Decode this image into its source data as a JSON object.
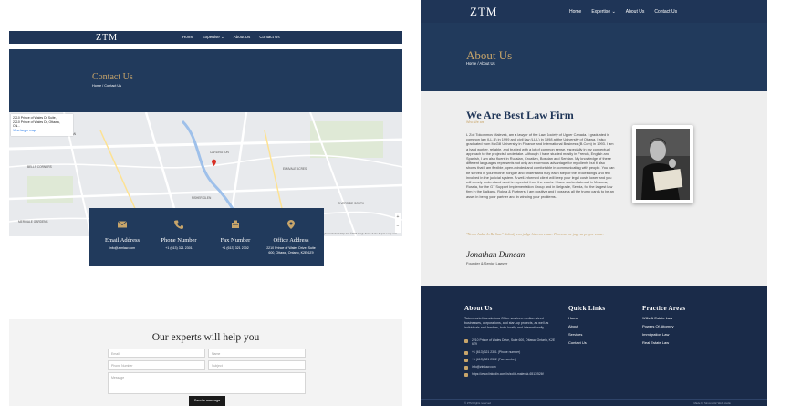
{
  "contact_page": {
    "nav": {
      "logo": "ZTM",
      "links": [
        "Home",
        "Expertise ⌄",
        "About Us",
        "Contact Us"
      ]
    },
    "hero": {
      "title": "Contact Us",
      "breadcrumb": "Home  /  Contact Us"
    },
    "map": {
      "card_address": "2210 Prince of Wales Dr Suite, 2210 Prince of Wales Dr, Ottawa, ON...",
      "card_link": "View larger map",
      "footer": "Keyboard shortcuts   Map data ©2023 Google   Terms of Use   Report a map error",
      "labels": [
        "NEPEAN",
        "CARLINGTON",
        "ELMVALE ACRES",
        "BELLS CORNERS",
        "MERIVALE GARDENS",
        "FISHER GLEN",
        "RIVERSIDE SOUTH"
      ]
    },
    "contact_cards": [
      {
        "heading": "Email Address",
        "detail": "info@ztmlaw.com",
        "icon": "envelope-icon"
      },
      {
        "heading": "Phone Number",
        "detail": "+1 (613) 321 2301",
        "icon": "phone-icon"
      },
      {
        "heading": "Fax Number",
        "detail": "+1 (613) 321 2302",
        "icon": "fax-icon"
      },
      {
        "heading": "Office Address",
        "detail": "2210 Prince of Wales Drive, Suite 600, Ottawa, Ontario, K2E 6Z9",
        "icon": "map-pin-icon"
      }
    ],
    "form": {
      "title": "Our experts will help you",
      "email_placeholder": "Email",
      "name_placeholder": "Name",
      "phone_placeholder": "Phone Number",
      "subject_placeholder": "Subject",
      "message_placeholder": "Message",
      "submit_label": "Send a message"
    }
  },
  "about_page": {
    "nav": {
      "logo": "ZTM",
      "links": [
        "Home",
        "Expertise ⌄",
        "About Us",
        "Contact Us"
      ]
    },
    "hero": {
      "title": "About Us",
      "breadcrumb": "Home  /  About Us"
    },
    "bio": {
      "title": "We Are Best Law Firm",
      "subtitle": "Who We are",
      "text": "L Zoli Tokommov Malevsk, am a lawyer of the Law Society of Upper Canada. I graduated in common law (LL.B) in 1999 and civil law (LL.L) in 1998 at the University of Ottawa. I also graduated from McGill University in Finance and International Business (B.Com) in 1993. I am a hard worker, reliable, and trusted with a lot of common sense, especially in my conceptual approach to the projects I undertake. Although I have studied mostly in French, English and Spanish, I am also fluent in Russian, Croatian, Bosnian and Serbian. My knowledge of these different languages represents not only an enormous advantage for my clients but it also shows that I am flexible, open-minded and comfortable in communicating with people. You can be served in your mother tongue and understand fully each step of the proceedings and feel involved in the judicial system. A well-informed client will keep your legal costs lower and you will clearly understand what is expected from the courts. I have worked abroad in Moscow, Russia, for the G7 Support Implementation Group and in Belgrade, Serbia, for the largest law firm in the Balkans, Roksa & Partners. I am positive and I possess all the trump cards to be an asset in being your partner and in winning your problems.",
      "quote": "\"Nemo Judex In Re Sua.\" Nobody can judge his own cause. Provenus ne juge sa propre cause.",
      "signature": "Jonathan Duncan",
      "role": "Founder & Senior Lawyer"
    },
    "footer": {
      "about_heading": "About Us",
      "about_text": "Tatomirovic-Maruda Law Office services medium sized businesses, corporations, and start-up projects, as well as individuals and families, both locally and internationally.",
      "address": "2210 Prince of Wales Drive, Suite 600, Ottawa, Ontario, K2E 6Z9",
      "phone": "+1 (613) 321 2301 (Phone number)",
      "fax": "+1 (613) 321 2302 (Fax number)",
      "email": "info@ztmlaw.com",
      "linkedin": "https://www.linkedin.com/in/zoli-t-malevsk-6513/526f",
      "quick_heading": "Quick Links",
      "quick_links": [
        "Home",
        "About",
        "Services",
        "Contact Us"
      ],
      "practice_heading": "Practice Areas",
      "practice_links": [
        "Wills & Estate Law",
        "Powers Of Attorney",
        "Immigration Law",
        "Real Estate Law"
      ],
      "copyright": "© ZTM Rights reserved",
      "made_by": "Made by Simomattic Web Studio"
    }
  },
  "colors": {
    "navy": "#213a5c",
    "gold": "#c8a56a",
    "footer": "#1a2b49"
  }
}
